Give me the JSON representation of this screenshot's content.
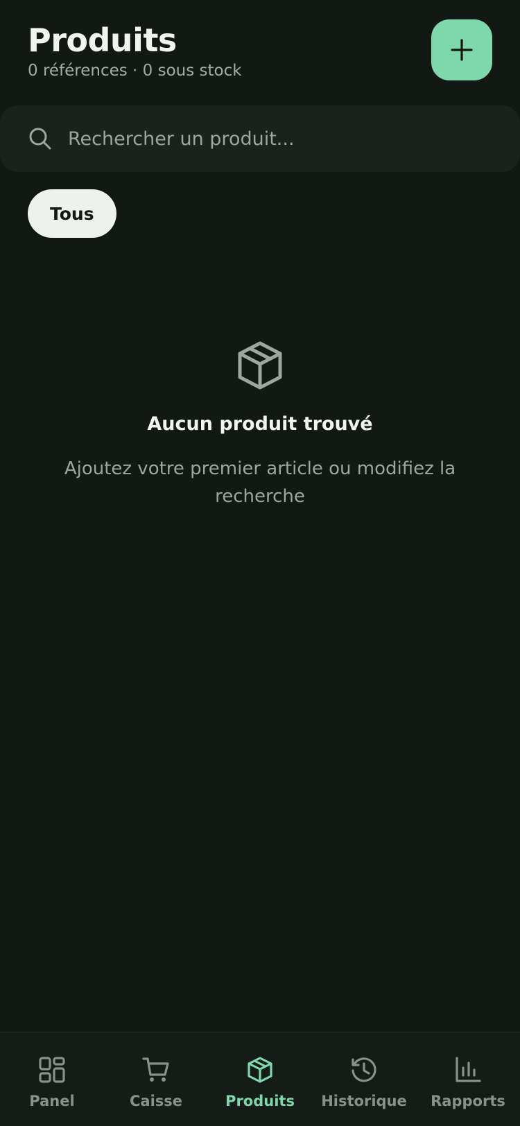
{
  "header": {
    "title": "Produits",
    "subtitle": "0 références · 0 sous stock",
    "add_icon": "plus-icon"
  },
  "search": {
    "placeholder": "Rechercher un produit...",
    "value": "",
    "icon": "search-icon"
  },
  "filters": [
    {
      "label": "Tous",
      "active": true
    }
  ],
  "empty_state": {
    "icon": "box-icon",
    "title": "Aucun produit trouvé",
    "text": "Ajoutez votre premier article ou modifiez la recherche"
  },
  "nav": {
    "items": [
      {
        "label": "Panel",
        "icon": "dashboard-icon",
        "active": false
      },
      {
        "label": "Caisse",
        "icon": "cart-icon",
        "active": false
      },
      {
        "label": "Produits",
        "icon": "box-icon",
        "active": true
      },
      {
        "label": "Historique",
        "icon": "history-icon",
        "active": false
      },
      {
        "label": "Rapports",
        "icon": "bar-chart-icon",
        "active": false
      }
    ]
  },
  "colors": {
    "background": "#121814",
    "surface": "#1b221d",
    "accent": "#7dd8ab",
    "text_primary": "#f1f4ef",
    "text_muted": "#9ea69d",
    "chip_bg": "#eef2ec"
  }
}
